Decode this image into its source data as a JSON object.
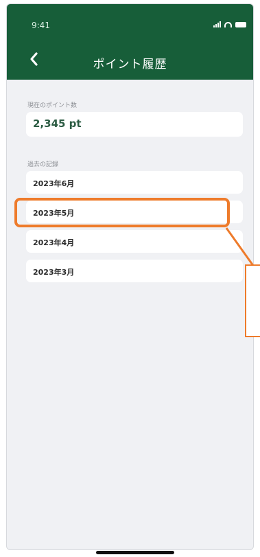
{
  "status": {
    "time": "9:41"
  },
  "header": {
    "title": "ポイント履歴"
  },
  "points": {
    "label": "現在のポイント数",
    "value": "2,345 pt"
  },
  "history": {
    "label": "過去の記録",
    "items": [
      "2023年6月",
      "2023年5月",
      "2023年4月",
      "2023年3月"
    ],
    "highlighted_index": 1
  },
  "colors": {
    "header_bg": "#175e39",
    "highlight": "#ee7b2b",
    "points_text": "#2c5c43"
  },
  "icons": {
    "back": "chevron-left-icon",
    "signal": "signal-icon",
    "wifi": "wifi-icon",
    "battery": "battery-icon"
  }
}
